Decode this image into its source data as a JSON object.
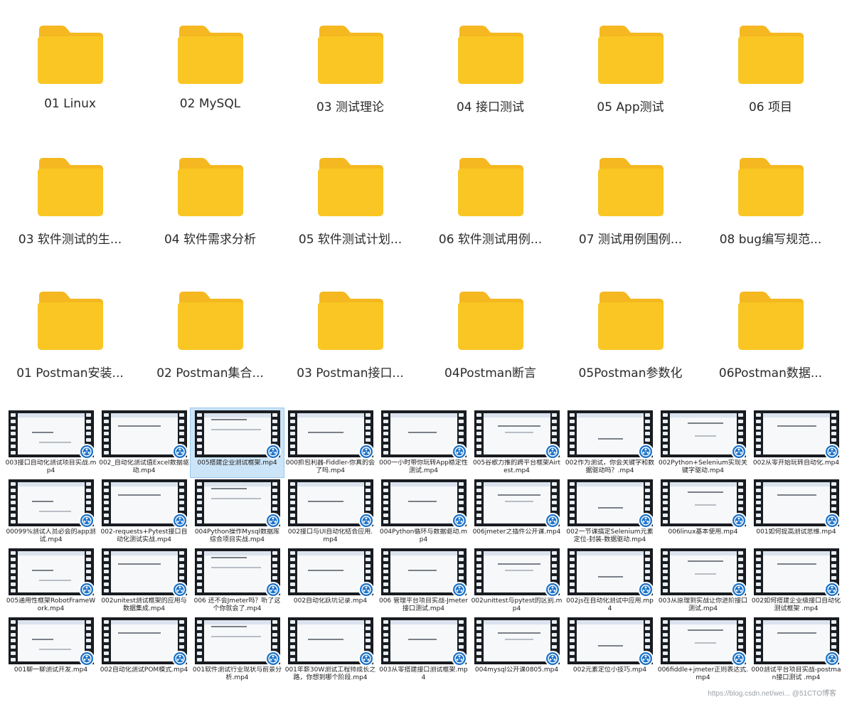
{
  "folders": [
    {
      "label": "01 Linux"
    },
    {
      "label": "02 MySQL"
    },
    {
      "label": "03 测试理论"
    },
    {
      "label": "04 接口测试"
    },
    {
      "label": "05 App测试"
    },
    {
      "label": "06 项目"
    },
    {
      "label": "03 软件测试的生..."
    },
    {
      "label": "04 软件需求分析"
    },
    {
      "label": "05 软件测试计划..."
    },
    {
      "label": "06 软件测试用例..."
    },
    {
      "label": "07 测试用例围例..."
    },
    {
      "label": "08 bug编写规范..."
    },
    {
      "label": "01 Postman安装..."
    },
    {
      "label": "02 Postman集合..."
    },
    {
      "label": "03 Postman接口..."
    },
    {
      "label": "04Postman断言"
    },
    {
      "label": "05Postman参数化"
    },
    {
      "label": "06Postman数据..."
    }
  ],
  "folder_color": "#f9c623",
  "folder_tab_color": "#f5b820",
  "videos": [
    {
      "label": "003接口自动化测试项目实战.mp4",
      "selected": false
    },
    {
      "label": "002_自动化测试值Excel数据驱动.mp4",
      "selected": false
    },
    {
      "label": "005搭建企业测试框架.mp4",
      "selected": true
    },
    {
      "label": "000抓包利器-Fiddler-你真的会了吗.mp4",
      "selected": false
    },
    {
      "label": "000一小时带你玩转App稳定性测试.mp4",
      "selected": false
    },
    {
      "label": "005谷歌力推的跨平台框架Airtest.mp4",
      "selected": false
    },
    {
      "label": "002作为测试，你会关键字和数据驱动吗？.mp4",
      "selected": false
    },
    {
      "label": "002Python+Selenium实现关键字驱动.mp4",
      "selected": false
    },
    {
      "label": "002从零开始玩转自动化.mp4",
      "selected": false
    },
    {
      "label": "00099%测试人员必会的app测试.mp4",
      "selected": false
    },
    {
      "label": "002-requests+Pytest接口自动化测试实战.mp4",
      "selected": false
    },
    {
      "label": "004Python操作Mysql数据库综合项目实战.mp4",
      "selected": false
    },
    {
      "label": "002接口与UI自动化结合应用.mp4",
      "selected": false
    },
    {
      "label": "004Python循环与数据驱动.mp4",
      "selected": false
    },
    {
      "label": "006jmeter之插件公开课.mp4",
      "selected": false
    },
    {
      "label": "002一节课搞定Selenium元素定位-封装-数据驱动.mp4",
      "selected": false
    },
    {
      "label": "006linux基本使用.mp4",
      "selected": false
    },
    {
      "label": "001如何提高测试思维.mp4",
      "selected": false
    },
    {
      "label": "005通用性框架RobotFrameWork.mp4",
      "selected": false
    },
    {
      "label": "002unitest测试框架的应用与数据集成.mp4",
      "selected": false
    },
    {
      "label": "006 还不会Jmeter吗？听了这个你就会了.mp4",
      "selected": false
    },
    {
      "label": "002自动化跃坑记录.mp4",
      "selected": false
    },
    {
      "label": "006 管理平台项目实战-Jmeter接口测试.mp4",
      "selected": false
    },
    {
      "label": "002unittest与pytest的区别.mp4",
      "selected": false
    },
    {
      "label": "002js在自动化测试中应用.mp4",
      "selected": false
    },
    {
      "label": "003从原理到实战让你进阶接口测试.mp4",
      "selected": false
    },
    {
      "label": "002如何搭建企业级接口自动化测试框架 .mp4",
      "selected": false
    },
    {
      "label": "001聊一聊测试开发.mp4",
      "selected": false
    },
    {
      "label": "002自动化测试POM模式.mp4",
      "selected": false
    },
    {
      "label": "001软件测试行业现状与前景分析.mp4",
      "selected": false
    },
    {
      "label": "001年薪30W测试工程师成长之路，你想到哪个阶段.mp4",
      "selected": false
    },
    {
      "label": "003从零搭建接口测试框架.mp4",
      "selected": false
    },
    {
      "label": "004mysql公开课0805.mp4",
      "selected": false
    },
    {
      "label": "002元素定位小技巧.mp4",
      "selected": false
    },
    {
      "label": "006fiddle+jmeter正则表达式.mp4",
      "selected": false
    },
    {
      "label": "000测试平台项目实战-postman接口测试 .mp4",
      "selected": false
    }
  ],
  "watermark": "https://blog.csdn.net/wei... @51CTO博客"
}
